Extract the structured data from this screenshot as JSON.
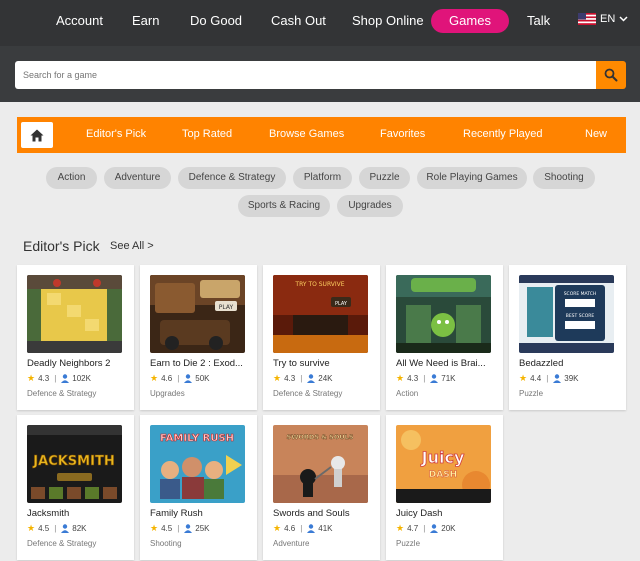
{
  "nav": {
    "items": [
      "Account",
      "Earn",
      "Do Good",
      "Cash Out",
      "Shop Online"
    ],
    "games": "Games",
    "talk": "Talk",
    "lang": "EN"
  },
  "search": {
    "placeholder": "Search for a game"
  },
  "tabs": [
    "Editor's Pick",
    "Top Rated",
    "Browse Games",
    "Favorites",
    "Recently Played",
    "New"
  ],
  "categories": [
    "Action",
    "Adventure",
    "Defence & Strategy",
    "Platform",
    "Puzzle",
    "Role Playing Games",
    "Shooting",
    "Sports & Racing",
    "Upgrades"
  ],
  "section": {
    "title": "Editor's Pick",
    "see_all": "See All >"
  },
  "games": [
    {
      "name": "Deadly Neighbors 2",
      "rating": "4.3",
      "plays": "102K",
      "category": "Defence & Strategy"
    },
    {
      "name": "Earn to Die 2 : Exod...",
      "rating": "4.6",
      "plays": "50K",
      "category": "Upgrades"
    },
    {
      "name": "Try to survive",
      "rating": "4.3",
      "plays": "24K",
      "category": "Defence & Strategy"
    },
    {
      "name": "All We Need is Brai...",
      "rating": "4.3",
      "plays": "71K",
      "category": "Action"
    },
    {
      "name": "Bedazzled",
      "rating": "4.4",
      "plays": "39K",
      "category": "Puzzle"
    },
    {
      "name": "Jacksmith",
      "rating": "4.5",
      "plays": "82K",
      "category": "Defence & Strategy"
    },
    {
      "name": "Family Rush",
      "rating": "4.5",
      "plays": "25K",
      "category": "Shooting"
    },
    {
      "name": "Swords and Souls",
      "rating": "4.6",
      "plays": "41K",
      "category": "Adventure"
    },
    {
      "name": "Juicy Dash",
      "rating": "4.7",
      "plays": "20K",
      "category": "Puzzle"
    }
  ],
  "thumb_text": {
    "try": "TRY TO SURVIVE",
    "play": "PLAY",
    "score": "SCORE MATCH",
    "best": "BEST SCORE",
    "jack": "JACKSMITH",
    "family": "FAMILY RUSH",
    "swords": "SWORDS & SOULS",
    "juicy": "Juicy",
    "dash": "DASH"
  },
  "icons": [
    "home-icon",
    "search-icon",
    "star-icon",
    "user-icon",
    "us-flag-icon",
    "chevron-down-icon"
  ],
  "colors": {
    "brand_pink": "#e0147a",
    "brand_orange": "#ff8300",
    "nav_dark": "#333436"
  }
}
